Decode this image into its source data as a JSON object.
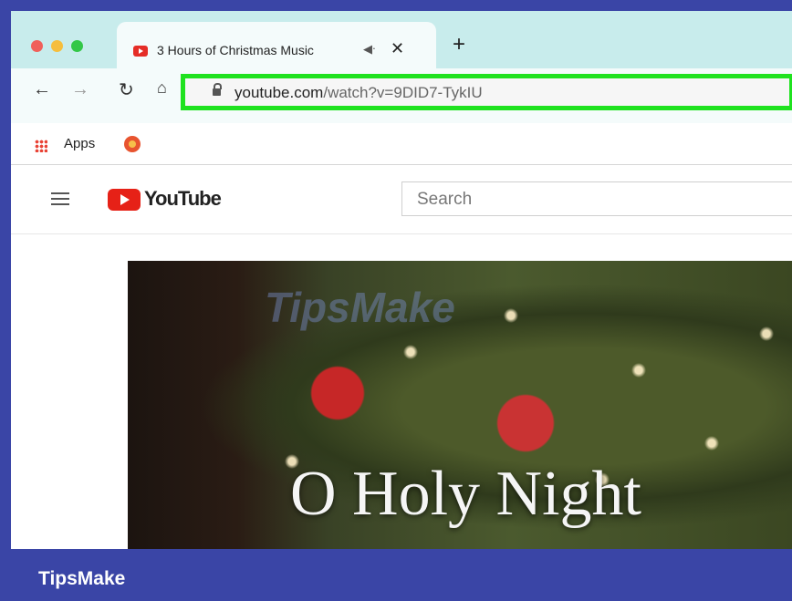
{
  "tab": {
    "title": "3 Hours of Christmas Music",
    "audio_icon": "speaker-icon",
    "close_label": "✕"
  },
  "new_tab_label": "+",
  "address_bar": {
    "domain": "youtube.com",
    "path": "/watch?v=9DID7-TykIU",
    "highlight_color": "#1fe21f"
  },
  "bookmarks": {
    "apps_label": "Apps"
  },
  "youtube": {
    "logo_text": "YouTube",
    "search_placeholder": "Search"
  },
  "video": {
    "caption": "O Holy Night",
    "watermark": "TipsMake"
  },
  "footer": {
    "brand": "TipsMake",
    "background": "#3a45a6"
  }
}
